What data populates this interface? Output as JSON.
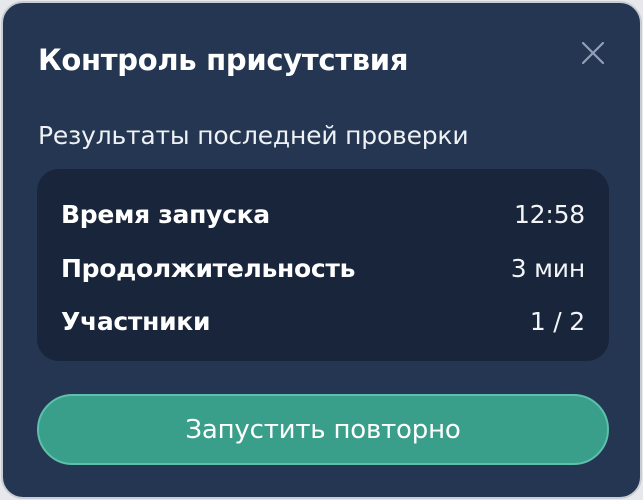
{
  "dialog": {
    "title": "Контроль присутствия",
    "close_icon": "close-icon",
    "subtitle": "Результаты последней проверки",
    "results": [
      {
        "label": "Время запуска",
        "value": "12:58"
      },
      {
        "label": "Продолжительность",
        "value": "3 мин"
      },
      {
        "label": "Участники",
        "value": "1 / 2"
      }
    ],
    "restart_label": "Запустить повторно"
  },
  "colors": {
    "background": "#243651",
    "card": "#18253a",
    "accent": "#3a9f8a",
    "text": "#ffffff",
    "close_icon": "#8fa0b8"
  }
}
